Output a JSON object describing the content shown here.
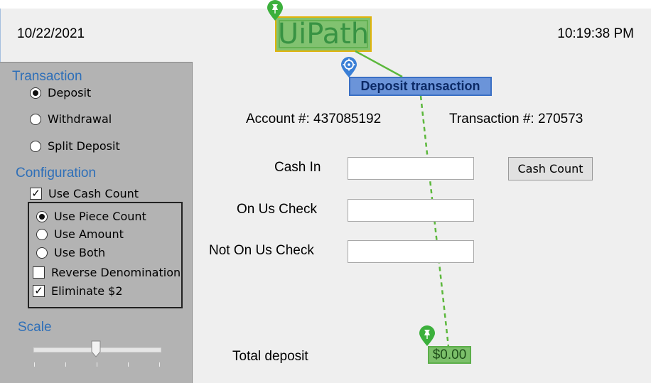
{
  "header": {
    "date": "10/22/2021",
    "time": "10:19:38 PM",
    "logo_text": "UiPath"
  },
  "anchor": {
    "label": "Deposit transaction"
  },
  "sidebar": {
    "transaction_title": "Transaction",
    "transaction_options": [
      {
        "label": "Deposit",
        "selected": true
      },
      {
        "label": "Withdrawal",
        "selected": false
      },
      {
        "label": "Split Deposit",
        "selected": false
      }
    ],
    "configuration_title": "Configuration",
    "use_cash_count": {
      "label": "Use Cash Count",
      "checked": true
    },
    "count_options": [
      {
        "label": "Use Piece Count",
        "selected": true
      },
      {
        "label": "Use Amount",
        "selected": false
      },
      {
        "label": "Use Both",
        "selected": false
      }
    ],
    "reverse_denomination": {
      "label": "Reverse Denomination",
      "checked": false
    },
    "eliminate_two": {
      "label": "Eliminate $2",
      "checked": true
    },
    "scale_title": "Scale",
    "scale_level": 0.5
  },
  "main": {
    "account_label": "Account #: 437085192",
    "transaction_label": "Transaction #: 270573",
    "cash_in_label": "Cash In",
    "cash_in_value": "",
    "on_us_check_label": "On Us Check",
    "on_us_check_value": "",
    "not_on_us_check_label": "Not On Us Check",
    "not_on_us_check_value": "",
    "cash_count_button": "Cash Count",
    "total_label": "Total deposit",
    "total_value": "$0.00"
  },
  "colors": {
    "section_title": "#2e6fb8",
    "highlight_green": "#7cc06a",
    "highlight_blue": "#6b94d9",
    "sidebar_bg": "#b3b3b3"
  }
}
